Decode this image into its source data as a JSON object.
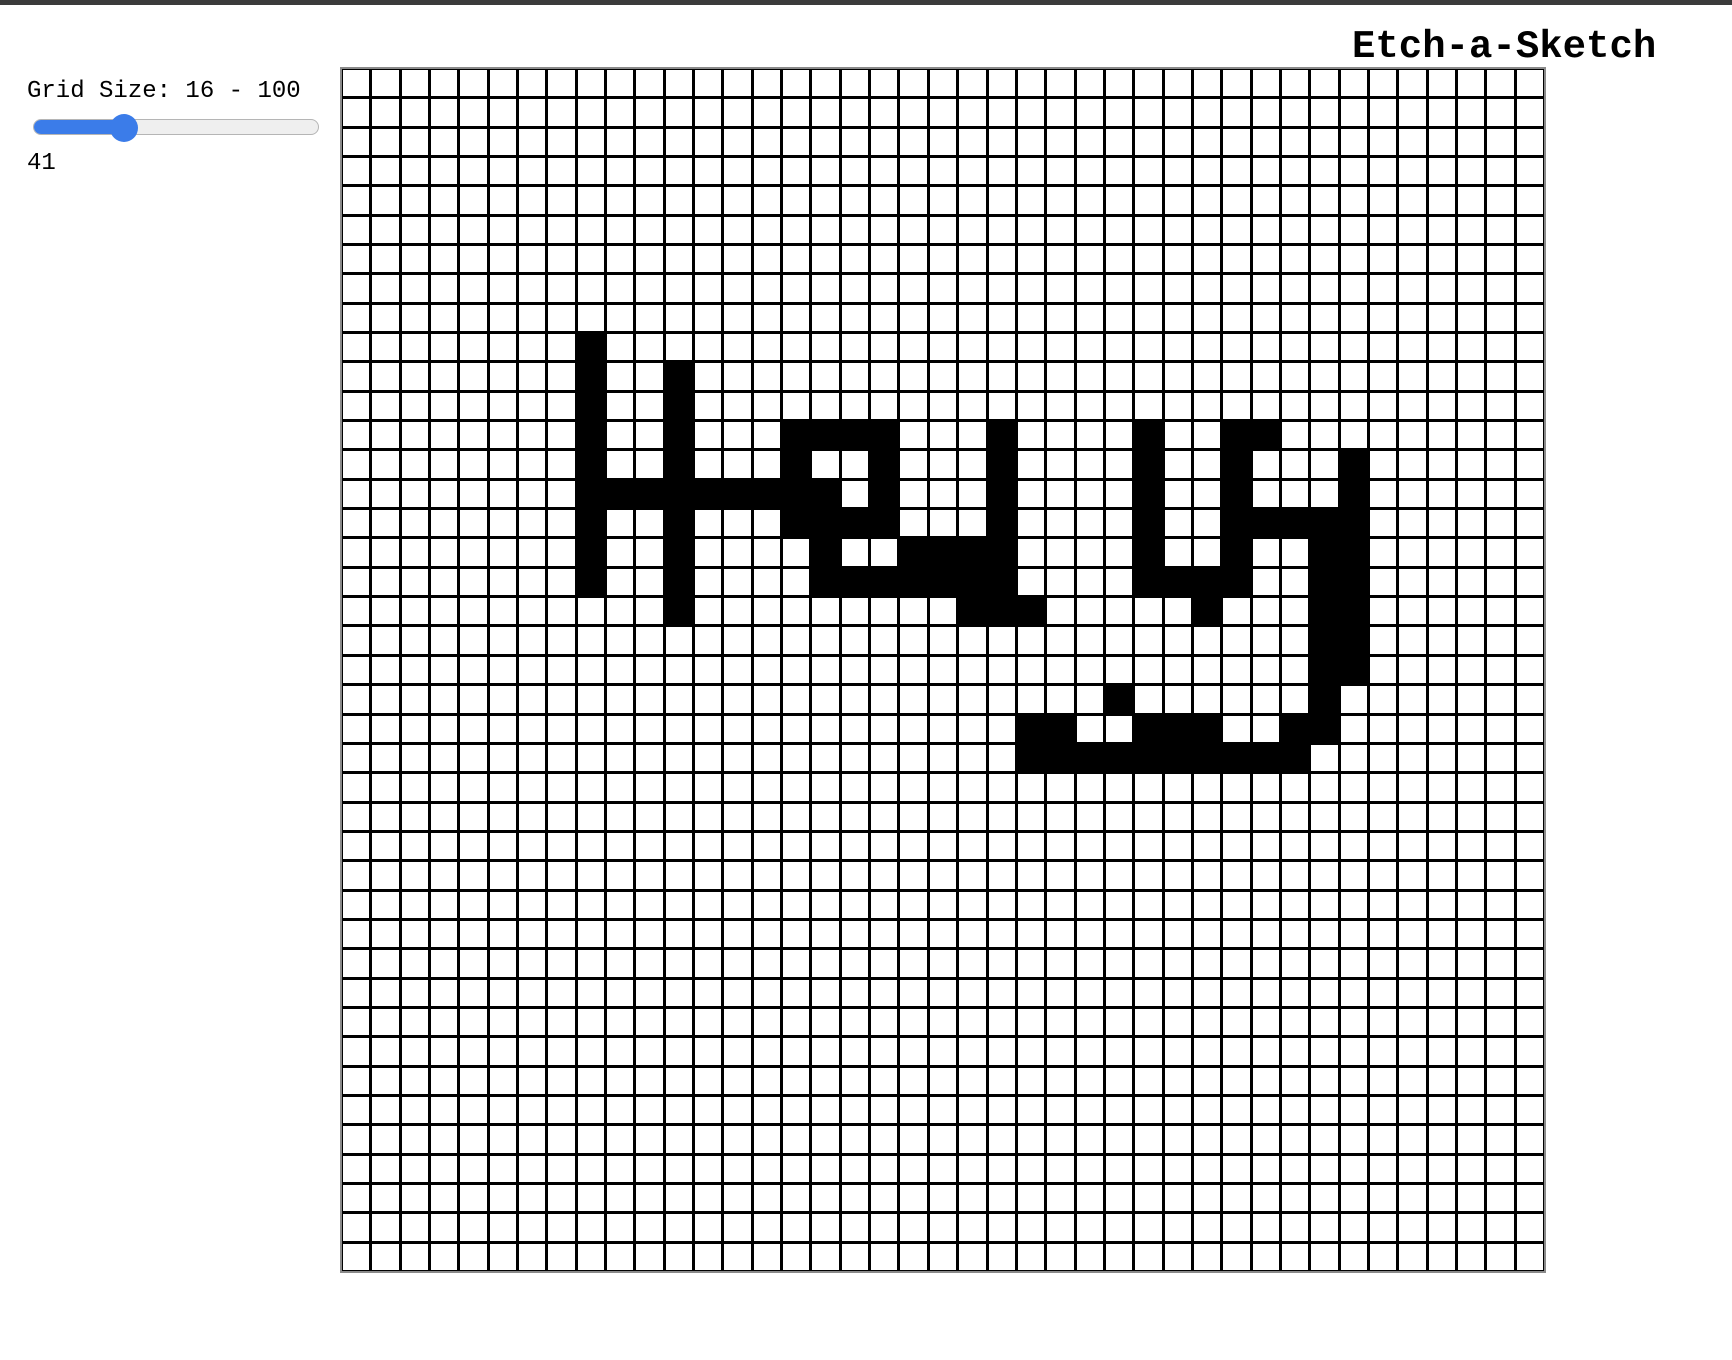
{
  "app": {
    "title": "Etch-a-Sketch"
  },
  "controls": {
    "label": "Grid Size: 16 - 100",
    "min": 16,
    "max": 100,
    "value": 41,
    "value_text": "41",
    "accent_color": "#3b7ce9"
  },
  "grid": {
    "size": 41,
    "pen_color": "#000000",
    "background_color": "#ffffff",
    "line_color": "#000000",
    "filled_cells": [
      [
        9,
        8
      ],
      [
        10,
        8
      ],
      [
        11,
        8
      ],
      [
        12,
        8
      ],
      [
        13,
        8
      ],
      [
        14,
        8
      ],
      [
        15,
        8
      ],
      [
        16,
        8
      ],
      [
        17,
        8
      ],
      [
        10,
        11
      ],
      [
        11,
        11
      ],
      [
        12,
        11
      ],
      [
        13,
        11
      ],
      [
        14,
        11
      ],
      [
        15,
        11
      ],
      [
        16,
        11
      ],
      [
        17,
        11
      ],
      [
        18,
        11
      ],
      [
        14,
        9
      ],
      [
        14,
        10
      ],
      [
        14,
        12
      ],
      [
        14,
        13
      ],
      [
        14,
        14
      ],
      [
        14,
        15
      ],
      [
        14,
        16
      ],
      [
        12,
        15
      ],
      [
        12,
        16
      ],
      [
        12,
        17
      ],
      [
        12,
        18
      ],
      [
        13,
        15
      ],
      [
        13,
        18
      ],
      [
        14,
        18
      ],
      [
        15,
        15
      ],
      [
        15,
        16
      ],
      [
        15,
        17
      ],
      [
        15,
        18
      ],
      [
        16,
        16
      ],
      [
        17,
        16
      ],
      [
        17,
        17
      ],
      [
        17,
        18
      ],
      [
        17,
        19
      ],
      [
        17,
        20
      ],
      [
        17,
        21
      ],
      [
        17,
        22
      ],
      [
        12,
        22
      ],
      [
        13,
        22
      ],
      [
        14,
        22
      ],
      [
        15,
        22
      ],
      [
        16,
        22
      ],
      [
        16,
        21
      ],
      [
        16,
        20
      ],
      [
        16,
        19
      ],
      [
        18,
        21
      ],
      [
        18,
        22
      ],
      [
        18,
        23
      ],
      [
        12,
        27
      ],
      [
        13,
        27
      ],
      [
        14,
        27
      ],
      [
        15,
        27
      ],
      [
        16,
        27
      ],
      [
        17,
        27
      ],
      [
        17,
        28
      ],
      [
        17,
        29
      ],
      [
        18,
        29
      ],
      [
        17,
        30
      ],
      [
        16,
        30
      ],
      [
        15,
        30
      ],
      [
        14,
        30
      ],
      [
        13,
        30
      ],
      [
        12,
        30
      ],
      [
        12,
        31
      ],
      [
        15,
        31
      ],
      [
        15,
        32
      ],
      [
        15,
        33
      ],
      [
        16,
        33
      ],
      [
        17,
        33
      ],
      [
        18,
        33
      ],
      [
        19,
        33
      ],
      [
        20,
        33
      ],
      [
        21,
        33
      ],
      [
        22,
        33
      ],
      [
        22,
        32
      ],
      [
        23,
        32
      ],
      [
        23,
        31
      ],
      [
        23,
        30
      ],
      [
        23,
        29
      ],
      [
        22,
        29
      ],
      [
        22,
        28
      ],
      [
        22,
        27
      ],
      [
        21,
        26
      ],
      [
        22,
        23
      ],
      [
        23,
        23
      ],
      [
        22,
        24
      ],
      [
        23,
        24
      ],
      [
        23,
        25
      ],
      [
        23,
        26
      ],
      [
        23,
        27
      ],
      [
        23,
        28
      ],
      [
        18,
        33
      ],
      [
        13,
        34
      ],
      [
        14,
        34
      ],
      [
        15,
        34
      ],
      [
        16,
        34
      ],
      [
        17,
        34
      ],
      [
        18,
        34
      ],
      [
        19,
        34
      ],
      [
        20,
        34
      ]
    ]
  }
}
